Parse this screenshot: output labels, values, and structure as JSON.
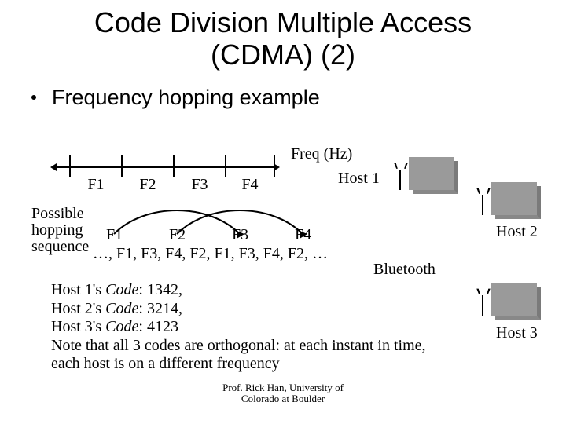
{
  "title_line1": "Code Division Multiple Access",
  "title_line2": "(CDMA) (2)",
  "bullet": "Frequency hopping example",
  "freq_axis": {
    "labels": [
      "F1",
      "F2",
      "F3",
      "F4"
    ],
    "caption": "Freq (Hz)"
  },
  "host1": "Host 1",
  "hop": {
    "label_l1": "Possible",
    "label_l2": "hopping",
    "label_l3": "sequence",
    "nodes": [
      "F1",
      "F2",
      "F3",
      "F4"
    ],
    "seq": "…, F1, F3, F4, F2, F1, F3, F4, F2, …"
  },
  "bluetooth": "Bluetooth",
  "codes": {
    "c1a": "Host 1's ",
    "c1b": "Code",
    "c1c": ": 1342,",
    "c2a": "Host 2's ",
    "c2b": "Code",
    "c2c": ": 3214,",
    "c3a": "Host 3's ",
    "c3b": "Code",
    "c3c": ": 4123",
    "note": "Note that all 3 codes are orthogonal: at each instant in time, each host is on a different frequency"
  },
  "host2": "Host 2",
  "host3": "Host 3",
  "footer_l1": "Prof. Rick Han, University of",
  "footer_l2": "Colorado at Boulder"
}
